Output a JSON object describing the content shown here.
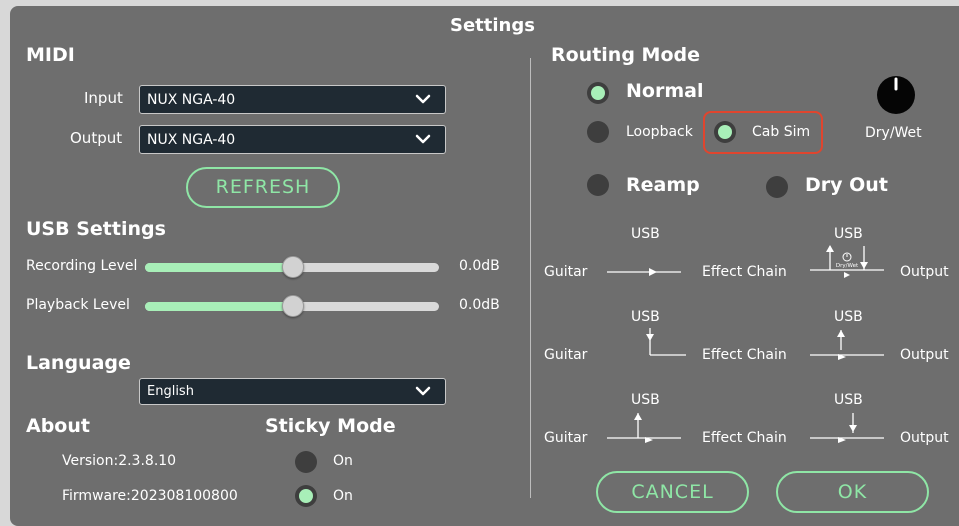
{
  "window": {
    "title": "Settings"
  },
  "midi": {
    "heading": "MIDI",
    "input_label": "Input",
    "input_value": "NUX NGA-40",
    "output_label": "Output",
    "output_value": "NUX NGA-40",
    "refresh_label": "REFRESH"
  },
  "usb": {
    "heading": "USB Settings",
    "recording_label": "Recording Level",
    "recording_value": "0.0dB",
    "recording_level_fraction": 0.5,
    "playback_label": "Playback Level",
    "playback_value": "0.0dB",
    "playback_level_fraction": 0.5
  },
  "language": {
    "heading": "Language",
    "value": "English"
  },
  "about": {
    "heading": "About",
    "version": "Version:2.3.8.10",
    "firmware": "Firmware:202308100800"
  },
  "sticky": {
    "heading": "Sticky Mode",
    "option1_label": "On",
    "option1_selected": false,
    "option2_label": "On",
    "option2_selected": true
  },
  "routing": {
    "heading": "Routing Mode",
    "normal": "Normal",
    "loopback": "Loopback",
    "cabsim": "Cab Sim",
    "reamp": "Reamp",
    "dryout": "Dry Out",
    "drywet": "Dry/Wet",
    "selected": [
      "Normal",
      "Cab Sim"
    ]
  },
  "diagram": {
    "usb": "USB",
    "guitar": "Guitar",
    "effect_chain": "Effect Chain",
    "output": "Output",
    "drywet_small": "Dry/Wet"
  },
  "footer": {
    "cancel": "CANCEL",
    "ok": "OK"
  },
  "colors": {
    "accent": "#8fe6a6",
    "panel": "#6e6e6e",
    "highlight": "#e0452e",
    "select_bg": "#1f2a33"
  },
  "icons": [
    "chevron-down-icon",
    "knob-icon",
    "radio-icon",
    "routing-arrow-icon"
  ]
}
